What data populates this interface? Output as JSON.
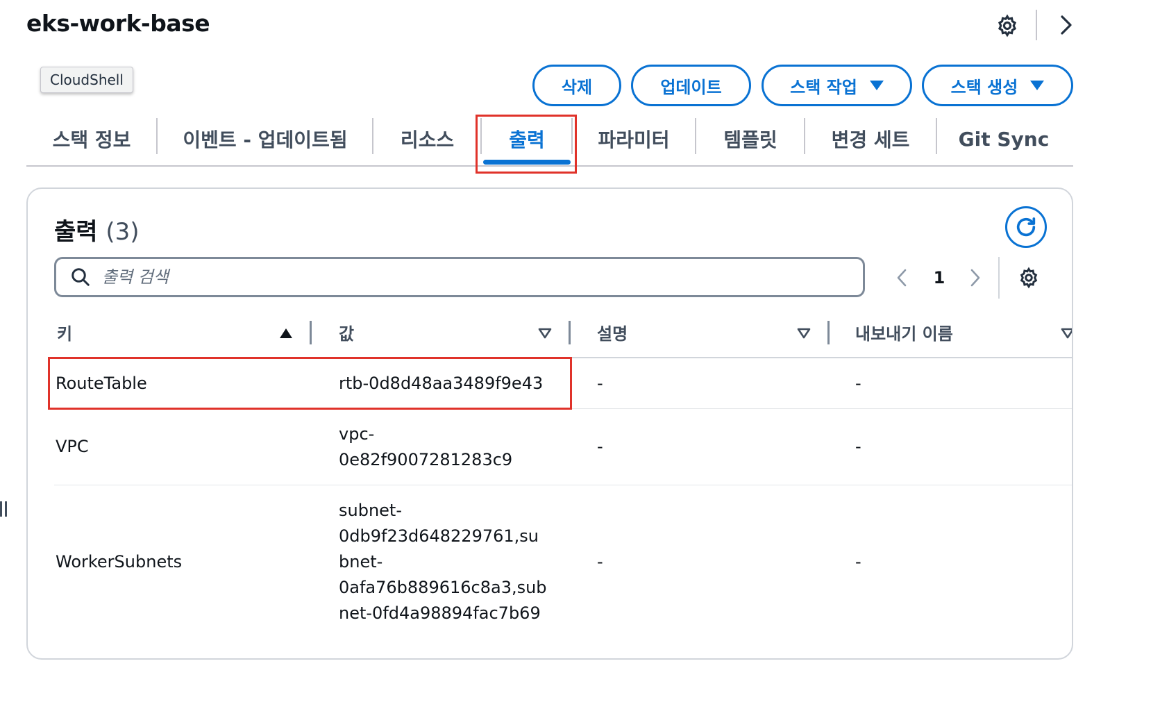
{
  "stack": {
    "title": "eks-work-base"
  },
  "tooltip": {
    "text": "CloudShell"
  },
  "actions": {
    "delete_label": "삭제",
    "update_label": "업데이트",
    "stack_actions_label": "스택 작업",
    "create_stack_label": "스택 생성"
  },
  "tabs": [
    {
      "label": "스택 정보"
    },
    {
      "label": "이벤트 - 업데이트됨"
    },
    {
      "label": "리소스"
    },
    {
      "label": "출력",
      "active": true
    },
    {
      "label": "파라미터"
    },
    {
      "label": "템플릿"
    },
    {
      "label": "변경 세트"
    },
    {
      "label": "Git Sync"
    }
  ],
  "outputs": {
    "title": "출력",
    "count": "(3)",
    "search_placeholder": "출력 검색",
    "page": "1",
    "columns": [
      {
        "label": "키",
        "sort": "ascending"
      },
      {
        "label": "값",
        "sort": "none"
      },
      {
        "label": "설명",
        "sort": "none"
      },
      {
        "label": "내보내기 이름",
        "sort": "none"
      }
    ],
    "rows": [
      {
        "key": "RouteTable",
        "value": "rtb-0d8d48aa3489f9e43",
        "description": "-",
        "export_name": "-"
      },
      {
        "key": "VPC",
        "value": "vpc-\n0e82f9007281283c9",
        "description": "-",
        "export_name": "-"
      },
      {
        "key": "WorkerSubnets",
        "value": "subnet-\n0db9f23d648229761,su\nbnet-\n0afa76b889616c8a3,sub\nnet-0fd4a98894fac7b69",
        "description": "-",
        "export_name": "-"
      }
    ]
  },
  "colors": {
    "accent": "#0972d3",
    "highlight": "#e0322a",
    "text": "#0f141a",
    "muted": "#414d5c"
  },
  "icons": [
    "gear-icon",
    "chevron-right-icon",
    "caret-down-icon",
    "refresh-icon",
    "search-icon",
    "chevron-left-icon",
    "sort-ascending-icon",
    "sort-descending-icon",
    "drag-handle-icon"
  ]
}
